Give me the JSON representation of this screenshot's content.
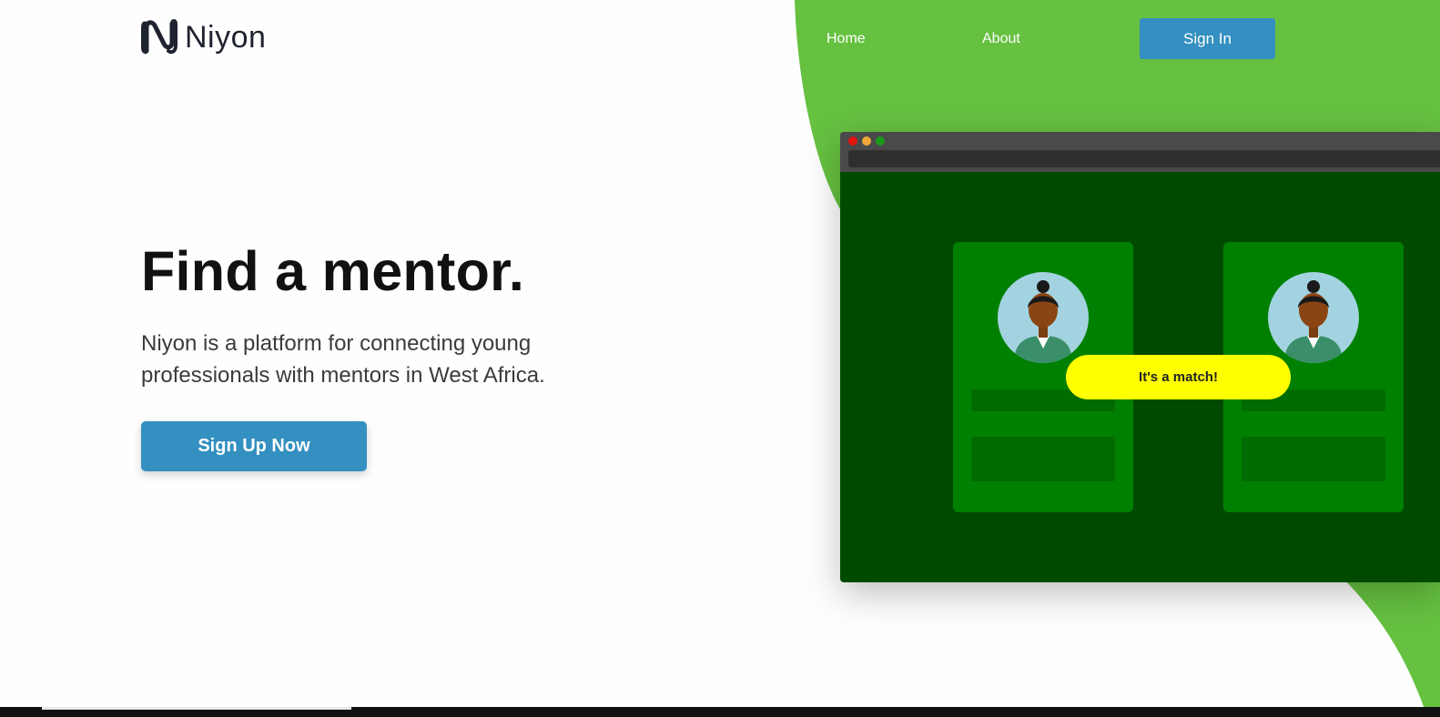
{
  "brand": {
    "name": "Niyon",
    "logo_icon": "niyon-n-logo-icon",
    "accent_green": "#66c140",
    "primary_blue": "#3490c0"
  },
  "nav": {
    "home_label": "Home",
    "about_label": "About",
    "signin_label": "Sign In"
  },
  "hero": {
    "title": "Find a mentor.",
    "subtitle": "Niyon is a platform for connecting young professionals with mentors in West Africa.",
    "cta_label": "Sign Up Now"
  },
  "illustration": {
    "window_dots": [
      "#e3130e",
      "#f2a93c",
      "#1a9a1a"
    ],
    "match_label": "It's a match!",
    "match_color": "#ffff00",
    "cards": [
      {
        "avatar": "mentor-avatar-icon"
      },
      {
        "avatar": "mentee-avatar-icon"
      }
    ]
  }
}
